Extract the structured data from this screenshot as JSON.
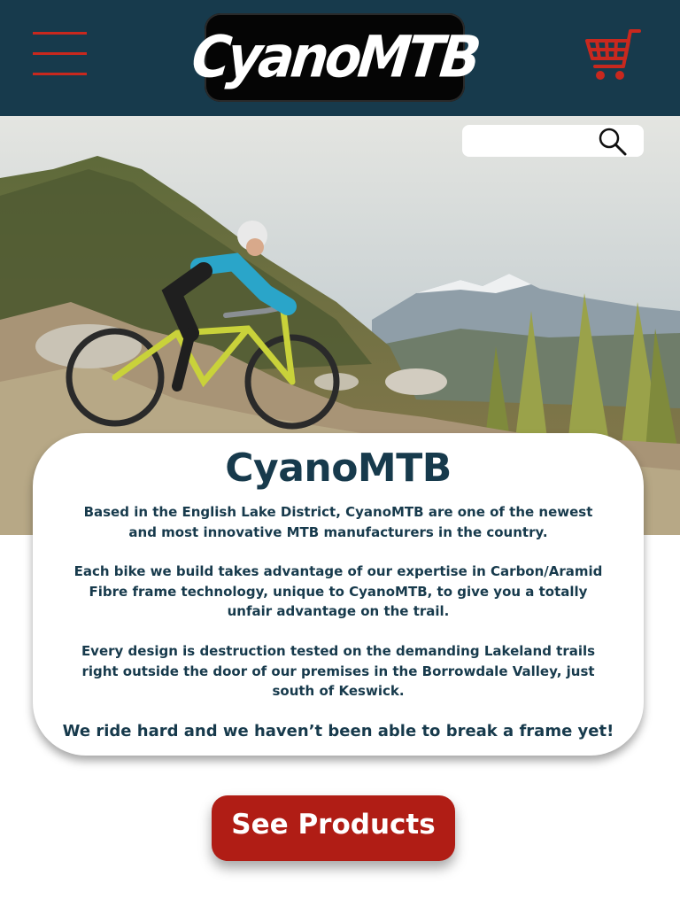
{
  "header": {
    "logo_text": "CyanoMTB",
    "menu_icon": "hamburger-menu-icon",
    "cart_icon": "shopping-cart-icon",
    "background_color": "#173a4c",
    "accent_color": "#c8281e"
  },
  "search": {
    "value": "",
    "icon": "search-icon"
  },
  "hero": {
    "image": "mountain-biker-on-alpine-trail"
  },
  "intro": {
    "title": "CyanoMTB",
    "paragraphs": [
      "Based in the English Lake District, CyanoMTB are one of the newest and most innovative MTB manufacturers in the country.",
      "Each bike we build takes advantage of our expertise in Carbon/Aramid Fibre frame technology, unique to CyanoMTB, to give you a totally unfair advantage on the trail.",
      "Every design is destruction tested on the demanding Lakeland trails right outside the door of our premises in the Borrowdale Valley, just south of Keswick."
    ],
    "tagline": "We ride hard and we haven’t been able to break a frame yet!"
  },
  "cta": {
    "label": "See Products",
    "color": "#b01d15"
  }
}
